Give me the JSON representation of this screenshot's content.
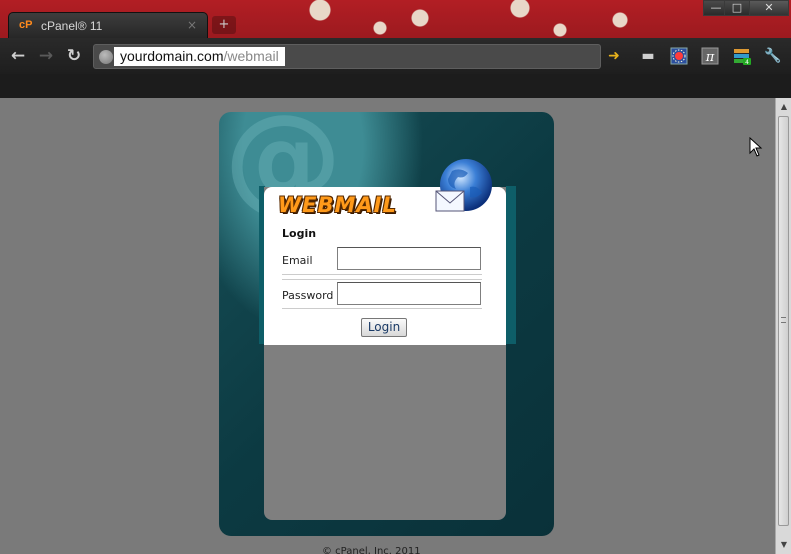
{
  "browser": {
    "tab_logo": "cP",
    "tab_title": "cPanel® 11",
    "tab_close": "×",
    "new_tab": "+",
    "url_domain": "yourdomain.com",
    "url_path": "/webmail",
    "window_buttons": [
      "—",
      "□",
      "✕"
    ]
  },
  "login": {
    "logo_text": "WEBMAIL",
    "heading": "Login",
    "email_label": "Email",
    "email_value": "",
    "password_label": "Password",
    "password_value": "",
    "button_label": "Login"
  },
  "footer": {
    "text": "© cPanel, Inc. 2011"
  },
  "colors": {
    "titlebar_red": "#b21e24",
    "card_teal": "#0c3a42",
    "logo_orange": "#ff9a1a"
  }
}
